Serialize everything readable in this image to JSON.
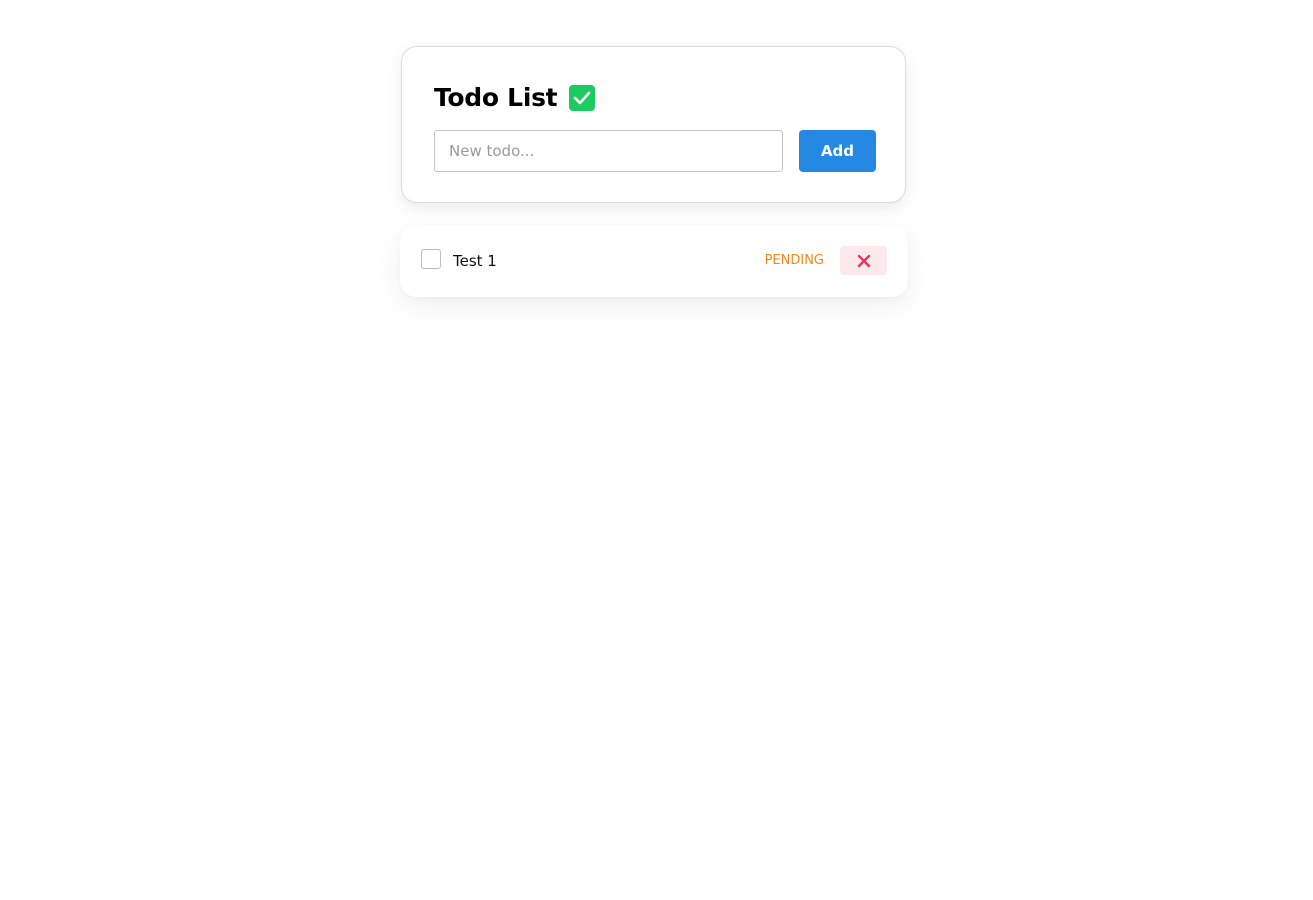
{
  "header": {
    "title": "Todo List",
    "title_icon": "check-square-icon"
  },
  "new_todo": {
    "placeholder": "New todo...",
    "value": ""
  },
  "add_button": {
    "label": "Add"
  },
  "todos": [
    {
      "text": "Test 1",
      "completed": false,
      "status": "PENDING",
      "delete_icon": "close-icon"
    }
  ],
  "colors": {
    "accent": "#2589e3",
    "success": "#1ccc61",
    "pending": "#f08a1c",
    "danger": "#e8345a",
    "danger_bg": "#fce9ec"
  }
}
